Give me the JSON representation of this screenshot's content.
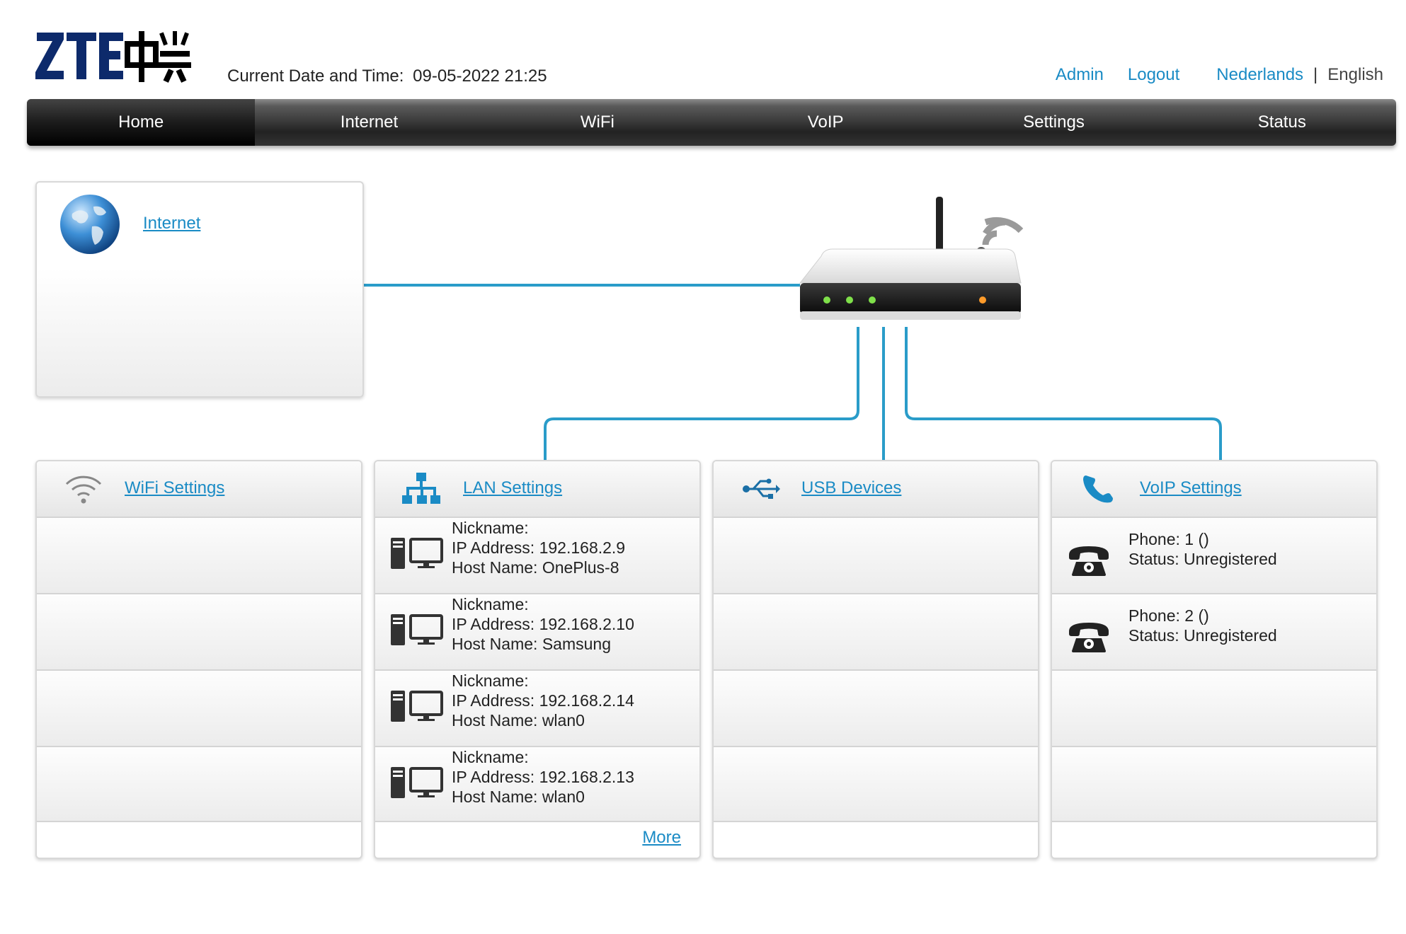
{
  "header": {
    "logo_text": "ZTE中兴",
    "datetime_label": "Current Date and Time:",
    "datetime_value": "09-05-2022 21:25",
    "admin_label": "Admin",
    "logout_label": "Logout",
    "lang_nl": "Nederlands",
    "lang_separator": "|",
    "lang_en": "English"
  },
  "nav": {
    "items": [
      {
        "label": "Home",
        "active": true
      },
      {
        "label": "Internet"
      },
      {
        "label": "WiFi"
      },
      {
        "label": "VoIP"
      },
      {
        "label": "Settings"
      },
      {
        "label": "Status"
      }
    ]
  },
  "internet_panel": {
    "icon": "globe-icon",
    "link_label": "Internet"
  },
  "wifi_panel": {
    "icon": "wifi-icon",
    "link_label": "WiFi Settings"
  },
  "lan_panel": {
    "icon": "network-icon",
    "link_label": "LAN Settings",
    "devices": [
      {
        "nickname": "Nickname:",
        "ip": "IP Address: 192.168.2.9",
        "host": "Host Name: OnePlus-8"
      },
      {
        "nickname": "Nickname:",
        "ip": "IP Address: 192.168.2.10",
        "host": "Host Name: Samsung"
      },
      {
        "nickname": "Nickname:",
        "ip": "IP Address: 192.168.2.14",
        "host": "Host Name: wlan0"
      },
      {
        "nickname": "Nickname:",
        "ip": "IP Address: 192.168.2.13",
        "host": "Host Name: wlan0"
      }
    ],
    "more_label": "More"
  },
  "usb_panel": {
    "icon": "usb-icon",
    "link_label": "USB Devices"
  },
  "voip_panel": {
    "icon": "phone-handset-icon",
    "link_label": "VoIP Settings",
    "phones": [
      {
        "phone": "Phone: 1 ()",
        "status": "Status: Unregistered"
      },
      {
        "phone": "Phone: 2 ()",
        "status": "Status: Unregistered"
      }
    ]
  },
  "colors": {
    "link": "#1a8bc5",
    "wire": "#2a9cc9",
    "nav_dark": "#222222"
  }
}
